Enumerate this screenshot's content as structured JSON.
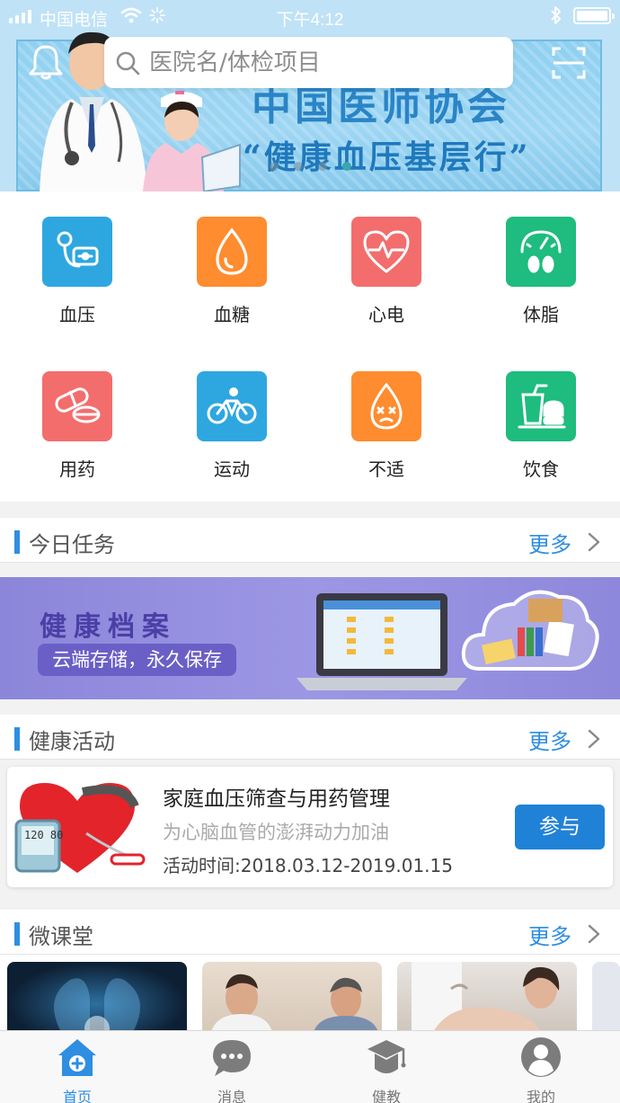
{
  "status_bar": {
    "carrier": "中国电信",
    "time": "下午4:12"
  },
  "search": {
    "placeholder": "医院名/体检项目"
  },
  "banner": {
    "line1": "中国医师协会",
    "line2": "“健康血压基层行”",
    "slides": 4,
    "active_slide": 4
  },
  "grid": {
    "items": [
      {
        "label": "血压",
        "icon": "blood-pressure-icon",
        "color": "#2ea7e0"
      },
      {
        "label": "血糖",
        "icon": "blood-drop-icon",
        "color": "#ff8c2e"
      },
      {
        "label": "心电",
        "icon": "heart-ecg-icon",
        "color": "#f36d6d"
      },
      {
        "label": "体脂",
        "icon": "scale-icon",
        "color": "#1ebc7e"
      },
      {
        "label": "用药",
        "icon": "pill-icon",
        "color": "#f36d6d"
      },
      {
        "label": "运动",
        "icon": "bicycle-icon",
        "color": "#2ea7e0"
      },
      {
        "label": "不适",
        "icon": "sick-face-icon",
        "color": "#ff8c2e"
      },
      {
        "label": "饮食",
        "icon": "food-drink-icon",
        "color": "#1ebc7e"
      }
    ]
  },
  "tasks": {
    "title": "今日任务",
    "more": "更多"
  },
  "health_file": {
    "title": "健康档案",
    "subtitle": "云端存储，永久保存"
  },
  "activities": {
    "title": "健康活动",
    "more": "更多",
    "card": {
      "name": "家庭血压筛查与用药管理",
      "desc": "为心脑血管的澎湃动力加油",
      "date": "活动时间:2018.03.12-2019.01.15",
      "button": "参与",
      "monitor_reading": "120 80"
    }
  },
  "courses": {
    "title": "微课堂",
    "more": "更多"
  },
  "tabbar": {
    "items": [
      {
        "label": "首页",
        "icon": "home-icon",
        "active": true
      },
      {
        "label": "消息",
        "icon": "chat-icon",
        "active": false
      },
      {
        "label": "健教",
        "icon": "graduation-cap-icon",
        "active": false
      },
      {
        "label": "我的",
        "icon": "user-icon",
        "active": false
      }
    ]
  },
  "colors": {
    "accent": "#2f8ee0",
    "button": "#2082d6"
  }
}
